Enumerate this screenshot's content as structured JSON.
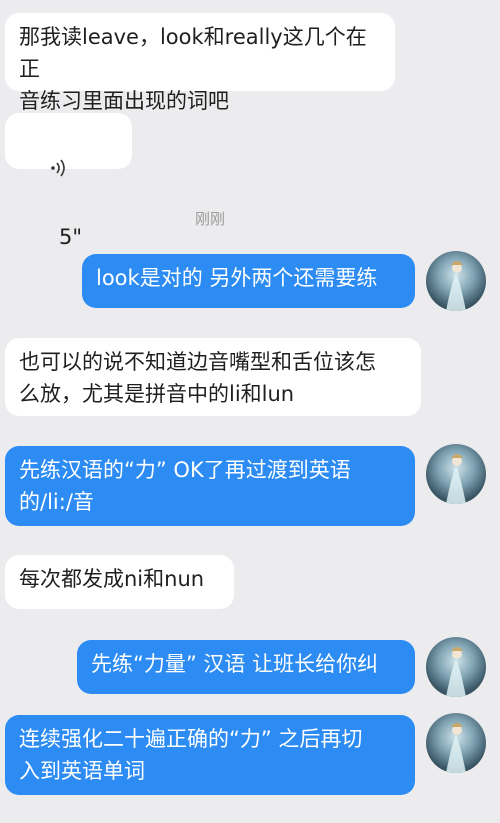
{
  "messages": [
    {
      "text": "那我读leave，look和really这几个在正\n音练习里面出现的词吧"
    },
    {
      "voice_duration": "5\""
    },
    {
      "text": "look是对的 另外两个还需要练"
    },
    {
      "text": "也可以的说不知道边音嘴型和舌位该怎\n么放，尤其是拼音中的li和lun"
    },
    {
      "text": "先练汉语的“力” OK了再过渡到英语\n的/li:/音"
    },
    {
      "text": "每次都发成ni和nun"
    },
    {
      "text": "先练“力量” 汉语 让班长给你纠"
    },
    {
      "text": "连续强化二十遍正确的“力” 之后再切\n入到英语单词"
    }
  ],
  "timestamp": "刚刚",
  "colors": {
    "outgoing": "#2d8cf3",
    "incoming": "#ffffff",
    "background": "#ececee"
  },
  "icons": {
    "voice": "voice-wave-icon",
    "avatar": "user-avatar"
  }
}
